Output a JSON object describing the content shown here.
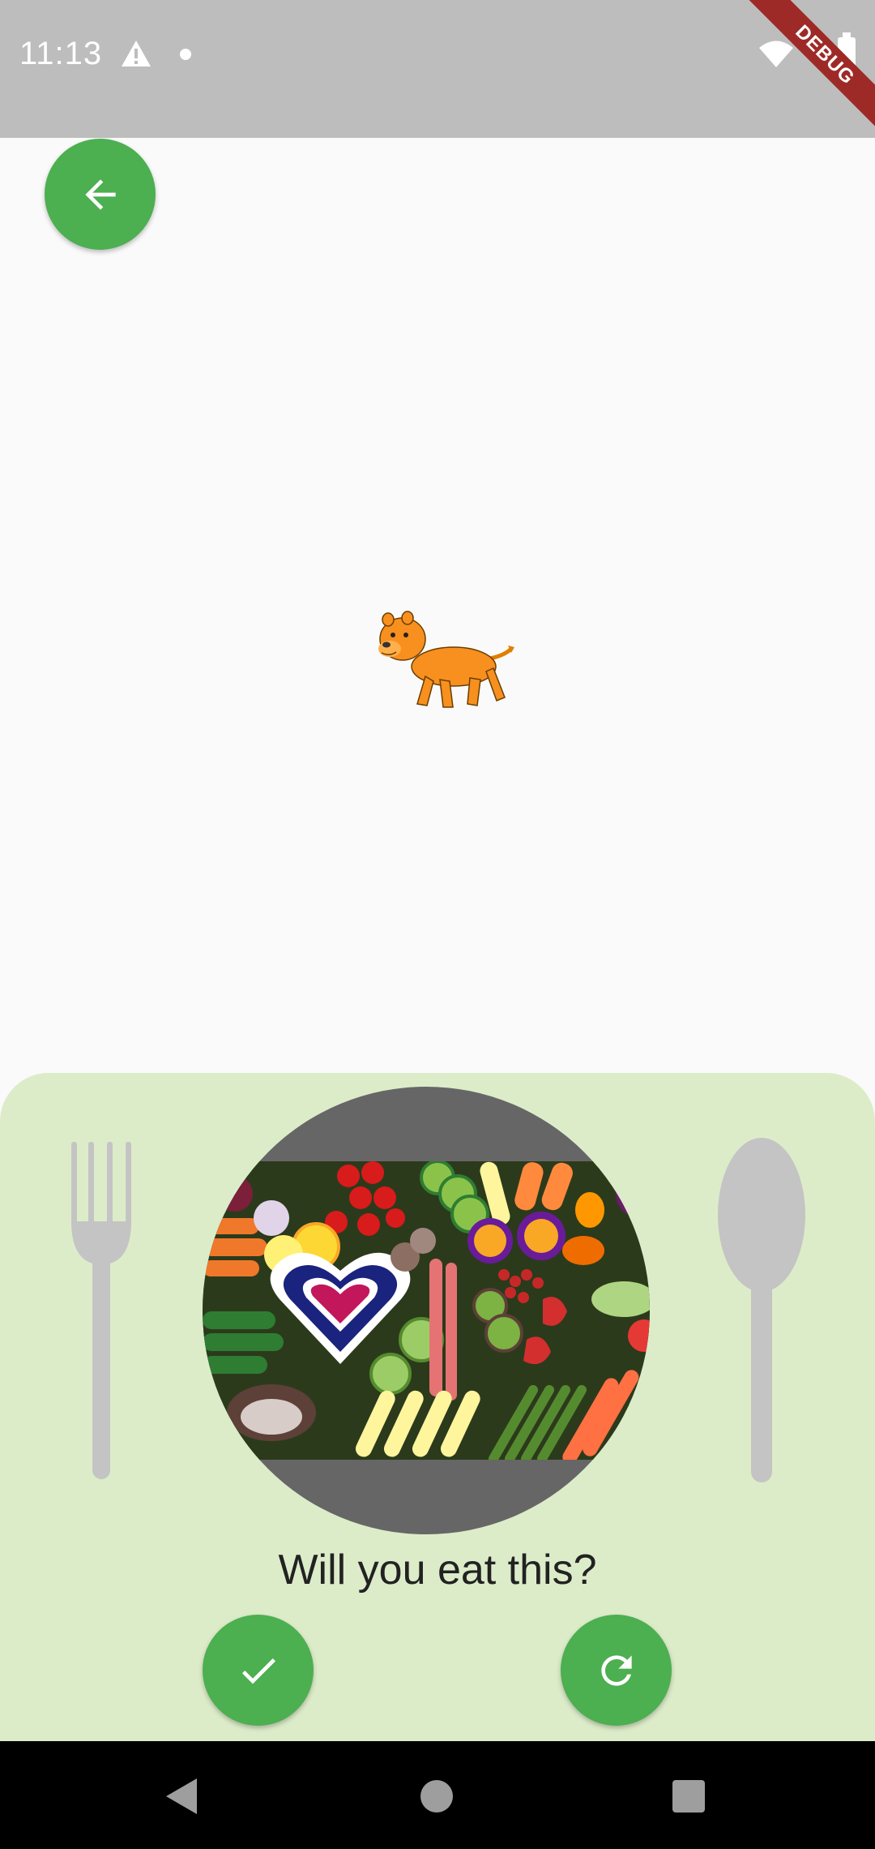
{
  "status_bar": {
    "time": "11:13",
    "icons": [
      "warning-icon",
      "notification-dot-icon",
      "wifi-icon",
      "battery-icon"
    ]
  },
  "debug_banner": {
    "label": "DEBUG"
  },
  "header": {
    "back_icon": "arrow-left-icon"
  },
  "main": {
    "animal_icon": "lion-illustration"
  },
  "meal_panel": {
    "question": "Will you eat this?",
    "plate_image": "vegetables-fruits-plate",
    "utensils": [
      "fork-icon",
      "spoon-icon"
    ],
    "actions": [
      {
        "name": "accept",
        "icon": "check-icon"
      },
      {
        "name": "refresh",
        "icon": "refresh-icon"
      }
    ]
  },
  "nav_bar": {
    "icons": [
      "nav-back-icon",
      "nav-home-icon",
      "nav-recents-icon"
    ]
  },
  "colors": {
    "accent_green": "#4caf50",
    "panel_background": "#dcecc9",
    "plate_gray": "#666666",
    "status_bar": "#bdbdbd",
    "debug_ribbon": "#9e2a28"
  }
}
